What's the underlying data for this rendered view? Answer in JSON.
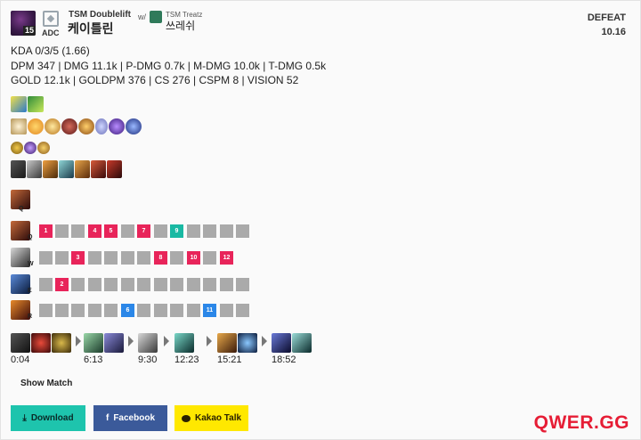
{
  "header": {
    "champion_level": "15",
    "role": "ADC",
    "player_name": "TSM Doublelift",
    "champion": "케이틀린",
    "with_label": "w/",
    "partner_name": "TSM Treatz",
    "partner_champion": "쓰레쉬",
    "result": "DEFEAT",
    "patch": "10.16"
  },
  "stats": {
    "kda": "KDA 0/3/5 (1.66)",
    "damage": "DPM 347 | DMG 11.1k | P-DMG 0.7k | M-DMG 10.0k | T-DMG 0.5k",
    "economy": "GOLD 12.1k | GOLDPM 376 | CS 276 | CSPM 8 | VISION 52"
  },
  "icons": {
    "summoner_spells": [
      "flash-spell",
      "heal-spell"
    ],
    "runes": [
      "rune-keystone",
      "rune-minor-1",
      "rune-minor-2",
      "rune-minor-3",
      "rune-minor-4",
      "rune-secondary-1",
      "rune-secondary-2",
      "rune-secondary-3"
    ],
    "shards": [
      "shard-1",
      "shard-2",
      "shard-3"
    ],
    "final_items": [
      "item-1",
      "item-2",
      "item-3",
      "item-4",
      "item-5",
      "item-6",
      "item-7"
    ],
    "max_skill_key": "Q"
  },
  "skill_order": {
    "rows": [
      {
        "key": "Q",
        "levels": [
          "1",
          "",
          "",
          "4",
          "5",
          "",
          "7",
          "",
          "9",
          "",
          "",
          "",
          ""
        ]
      },
      {
        "key": "W",
        "levels": [
          "",
          "",
          "3",
          "",
          "",
          "",
          "",
          "8",
          "",
          "10",
          "",
          "12",
          ""
        ]
      },
      {
        "key": "E",
        "levels": [
          "",
          "2",
          "",
          "",
          "",
          "",
          "",
          "",
          "",
          "",
          "",
          "",
          ""
        ]
      },
      {
        "key": "R",
        "levels": [
          "",
          "",
          "",
          "",
          "",
          "6",
          "",
          "",
          "",
          "",
          "11",
          "",
          ""
        ]
      }
    ]
  },
  "build": [
    {
      "time": "0:04",
      "items": 3
    },
    {
      "time": "6:13",
      "items": 2
    },
    {
      "time": "9:30",
      "items": 1
    },
    {
      "time": "12:23",
      "items": 1
    },
    {
      "time": "15:21",
      "items": 2
    },
    {
      "time": "18:52",
      "items": 2
    }
  ],
  "actions": {
    "show_match": "Show Match",
    "download": "Download",
    "facebook": "Facebook",
    "kakao": "Kakao Talk"
  },
  "brand": {
    "logo": "QWER.GG",
    "accent": "#e61d35",
    "skill_color": "#e8245a",
    "ult_color": "#2b87e8",
    "download_color": "#1ec4ad",
    "facebook_color": "#3b5a9a",
    "kakao_color": "#ffe800"
  }
}
